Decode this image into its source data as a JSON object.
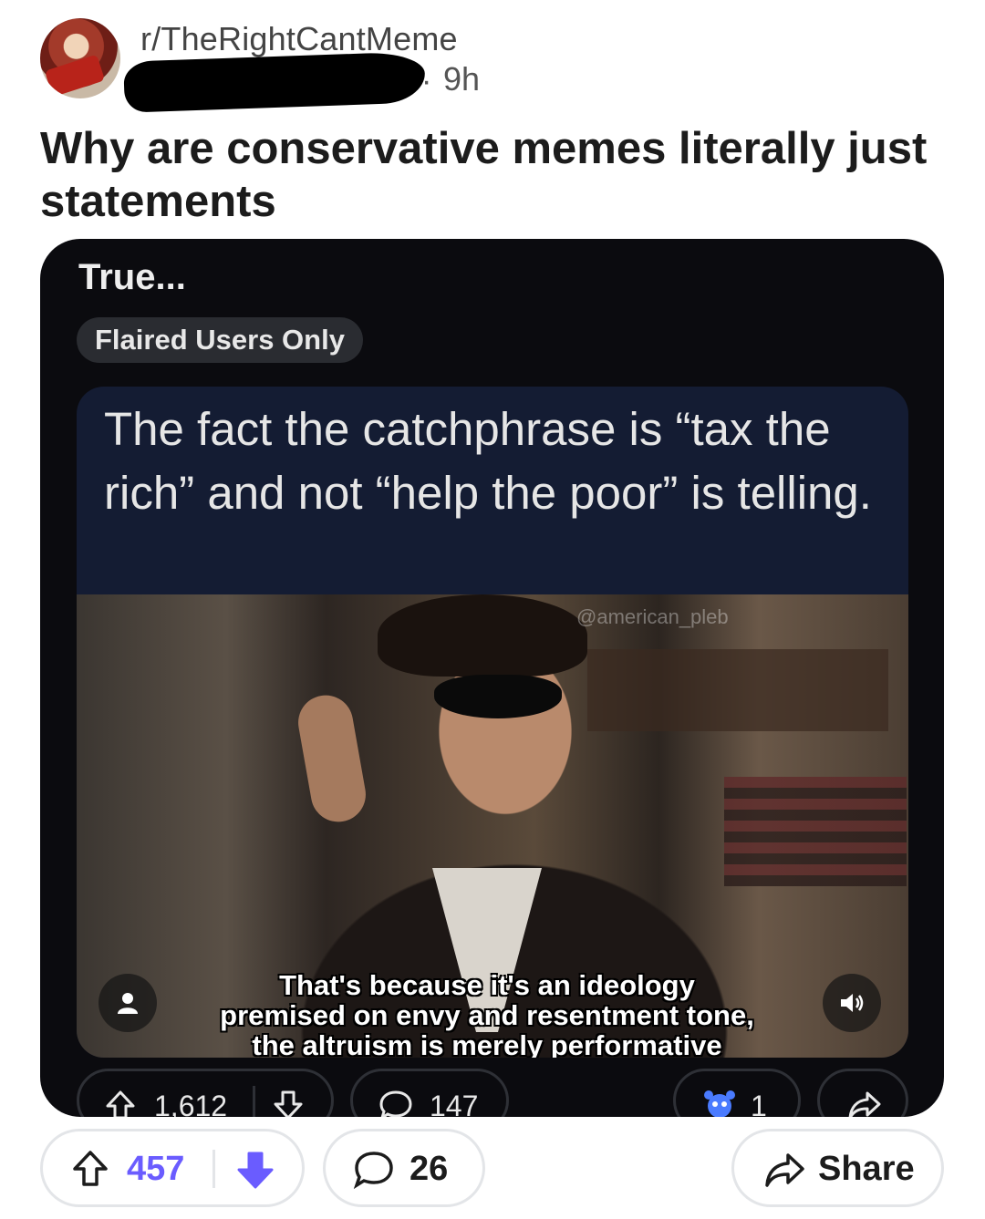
{
  "post": {
    "subreddit": "r/TheRightCantMeme",
    "time": "9h",
    "title": "Why are conservative memes literally just statements"
  },
  "embedded": {
    "title": "True...",
    "flair": "Flaired Users Only",
    "meme_text": "The fact the catchphrase is “tax the rich” and not “help the poor” is telling.",
    "watermark": "@american_pleb",
    "caption_lines": [
      "That's because it's an ideology",
      "premised on envy and resentment tone,",
      "the altruism is merely performative"
    ],
    "upvotes": "1,612",
    "comments": "147",
    "awards": "1"
  },
  "actions": {
    "upvotes": "457",
    "comments": "26",
    "share_label": "Share"
  },
  "colors": {
    "vote_accent": "#6a5cff",
    "card_bg": "#0b0b0f",
    "meme_bg": "#141c33"
  },
  "icons": [
    "upvote-icon",
    "downvote-icon",
    "comment-icon",
    "share-icon",
    "award-icon",
    "user-icon",
    "sound-icon"
  ]
}
